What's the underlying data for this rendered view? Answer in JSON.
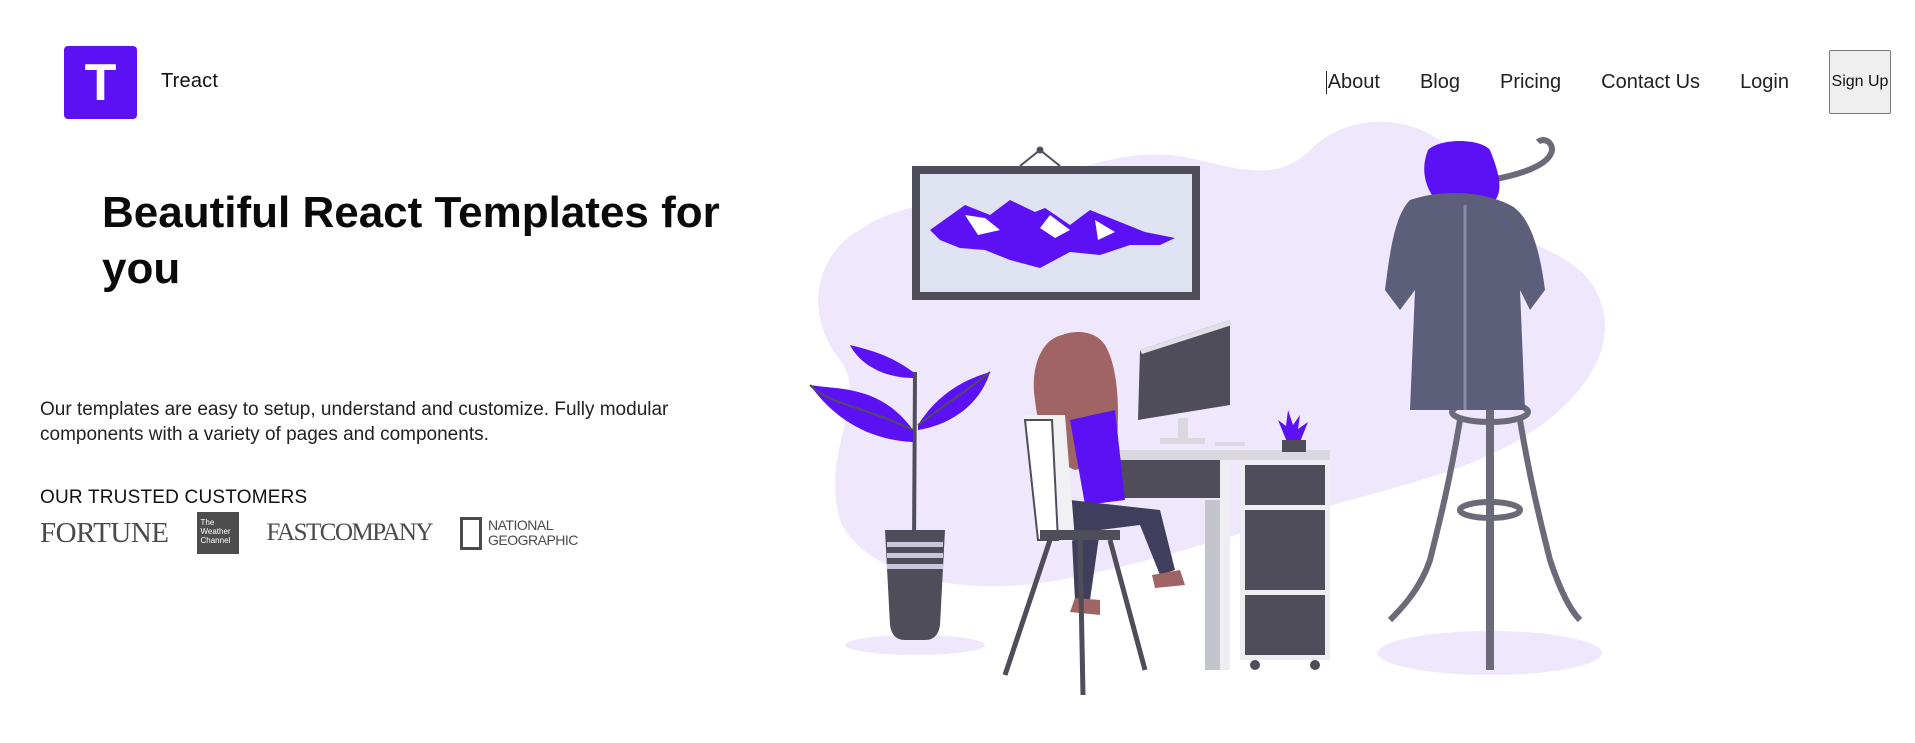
{
  "header": {
    "logo_letter": "T",
    "brand_name": "Treact",
    "nav": {
      "about": "About",
      "blog": "Blog",
      "pricing": "Pricing",
      "contact": "Contact Us",
      "login": "Login",
      "signup": "Sign Up"
    }
  },
  "hero": {
    "title": "Beautiful React Templates for you",
    "description": "Our templates are easy to setup, understand and customize. Fully modular components with a variety of pages and components."
  },
  "customers": {
    "heading": "OUR TRUSTED CUSTOMERS",
    "fortune": "FORTUNE",
    "weather": {
      "line1": "The",
      "line2": "Weather",
      "line3": "Channel"
    },
    "fastcompany": "FASTCOMPANY",
    "natgeo": {
      "line1": "NATIONAL",
      "line2": "GEOGRAPHIC"
    }
  },
  "colors": {
    "accent": "#5c11f5",
    "blob": "#efe8fd",
    "dark": "#4f4d59",
    "coat": "#5c5e7a"
  }
}
